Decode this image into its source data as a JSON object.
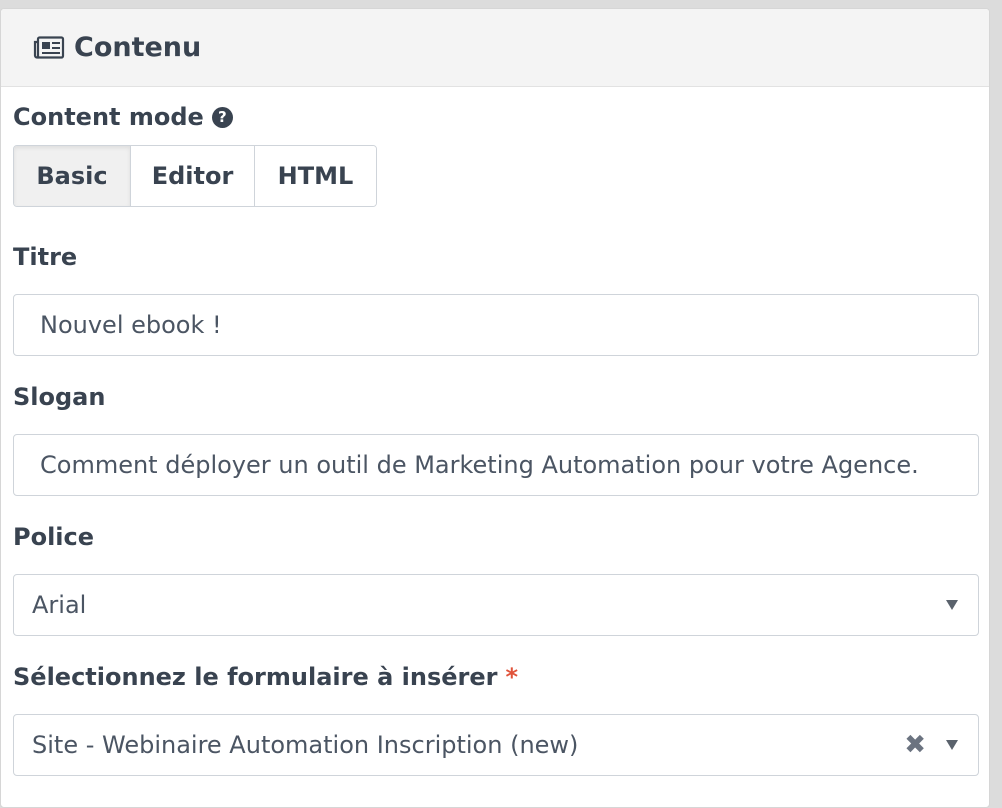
{
  "panel": {
    "title": "Contenu",
    "icon": "newspaper-icon"
  },
  "content_mode": {
    "label": "Content mode",
    "help_icon": "?",
    "options": [
      "Basic",
      "Editor",
      "HTML"
    ],
    "selected": "Basic"
  },
  "titre": {
    "label": "Titre",
    "value": "Nouvel ebook !"
  },
  "slogan": {
    "label": "Slogan",
    "value": "Comment déployer un outil de Marketing Automation pour votre Agence."
  },
  "police": {
    "label": "Police",
    "value": "Arial"
  },
  "form_select": {
    "label": "Sélectionnez le formulaire à insérer",
    "required_mark": "*",
    "value": "Site - Webinaire Automation Inscription (new)",
    "clear_glyph": "✖"
  },
  "colors": {
    "required": "#e0533a",
    "text": "#394350",
    "header_bg": "#f4f4f4"
  }
}
